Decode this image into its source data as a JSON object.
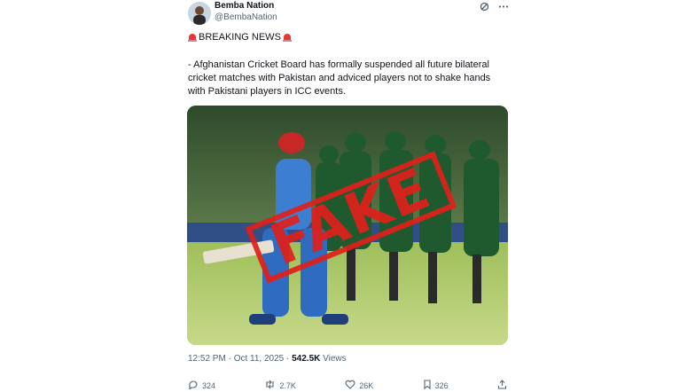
{
  "author": {
    "name": "Bemba Nation",
    "handle": "@BembaNation"
  },
  "icons": {
    "header": [
      "grok-icon",
      "more-options-icon"
    ],
    "actions": [
      "reply-icon",
      "retweet-icon",
      "like-icon",
      "bookmark-icon",
      "share-icon"
    ]
  },
  "post": {
    "headline": "BREAKING NEWS",
    "text": "- Afghanistan Cricket Board has formally suspended all future bilateral cricket matches with Pakistan and adviced players not to shake hands with Pakistani players in ICC events.",
    "stamp": "FAKE",
    "timestamp": "12:52 PM · Oct 11, 2025 · ",
    "views_count": "542.5K",
    "views_label": " Views"
  },
  "actions": {
    "replies": "324",
    "reposts": "2.7K",
    "likes": "26K",
    "bookmarks": "326"
  },
  "colors": {
    "stamp": "#e0201b",
    "siren": "#e53935",
    "muted": "#536471"
  }
}
